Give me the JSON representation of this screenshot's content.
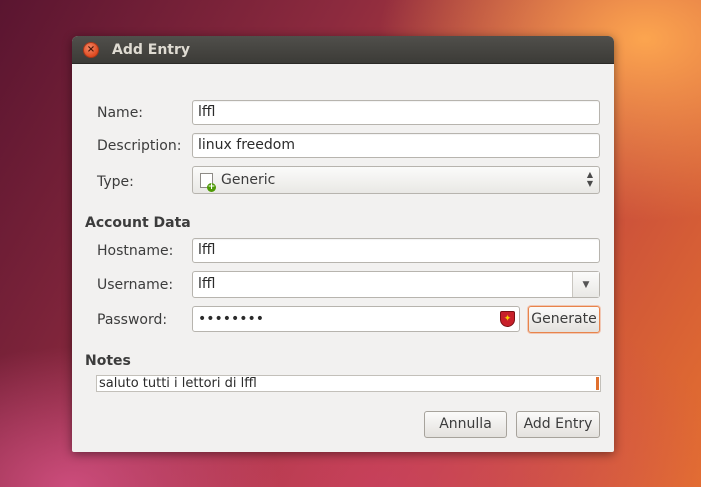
{
  "window": {
    "title": "Add Entry"
  },
  "form": {
    "name_label": "Name:",
    "name_value": "lffl",
    "description_label": "Description:",
    "description_value": "linux freedom",
    "type_label": "Type:",
    "type_value": "Generic"
  },
  "account": {
    "section_title": "Account Data",
    "hostname_label": "Hostname:",
    "hostname_value": "lffl",
    "username_label": "Username:",
    "username_value": "lffl",
    "password_label": "Password:",
    "password_value": "••••••••",
    "generate_label": "Generate"
  },
  "notes": {
    "section_title": "Notes",
    "value": "saluto tutti i lettori di lffl"
  },
  "buttons": {
    "cancel_label": "Annulla",
    "add_label": "Add Entry"
  },
  "icons": {
    "close": "close-icon",
    "type": "generic-document-icon",
    "password_strength": "shield-icon",
    "dropdown": "chevron-down-icon"
  },
  "colors": {
    "close_button": "#df4a20",
    "focus_accent": "#e8844b",
    "titlebar": "#3c3b37",
    "dialog_bg": "#f2f1f0"
  }
}
